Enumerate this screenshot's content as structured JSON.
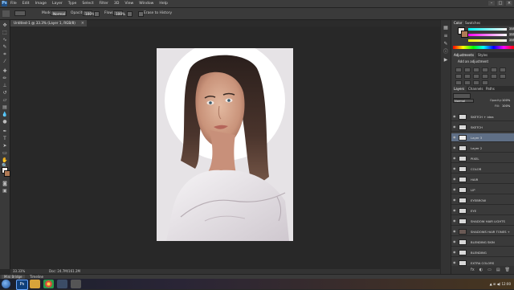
{
  "menubar": {
    "logo": "Ps",
    "items": [
      "File",
      "Edit",
      "Image",
      "Layer",
      "Type",
      "Select",
      "Filter",
      "3D",
      "View",
      "Window",
      "Help"
    ],
    "window_controls": [
      "–",
      "□",
      "×"
    ]
  },
  "options_bar": {
    "mode_label": "Mode:",
    "mode_value": "Normal",
    "opacity_label": "Opacity:",
    "opacity_value": "100%",
    "flow_label": "Flow:",
    "flow_value": "100%",
    "erase_history_label": "Erase to History"
  },
  "document_tab": {
    "title": "Untitled-1 @ 33.3% (Layer 1, RGB/8)",
    "close": "×"
  },
  "status_bar": {
    "zoom": "33.33%",
    "doc_info": "Doc: 24.7M/161.2M"
  },
  "mini_bridge": {
    "tabs": [
      "Mini Bridge",
      "Timeline"
    ]
  },
  "taskbar": {
    "apps": [
      "Ps",
      "",
      "",
      "",
      ""
    ],
    "tray_text": "▲ ⊞ ◀) 12:00"
  },
  "panels": {
    "color_tabs": [
      "Color",
      "Swatches"
    ],
    "slider_values": [
      "255",
      "255",
      "255"
    ],
    "adjust_tabs": [
      "Adjustments",
      "Styles"
    ],
    "adjust_title": "Add an adjustment",
    "layer_tabs": [
      "Layers",
      "Channels",
      "Paths"
    ],
    "blend_mode": "Normal",
    "opacity_label": "Opacity:",
    "opacity_value": "100%",
    "fill_label": "Fill:",
    "fill_value": "100%",
    "layers": [
      {
        "name": "SKETCH + idea",
        "selected": false
      },
      {
        "name": "SKETCH",
        "selected": false
      },
      {
        "name": "Layer 3",
        "selected": true
      },
      {
        "name": "Layer 2",
        "selected": false
      },
      {
        "name": "PIXEL",
        "selected": false
      },
      {
        "name": "COLOR",
        "selected": false
      },
      {
        "name": "HAIR",
        "selected": false
      },
      {
        "name": "LIP",
        "selected": false
      },
      {
        "name": "EYEBROW",
        "selected": false
      },
      {
        "name": "EYE",
        "selected": false
      },
      {
        "name": "SHADOW HAIR LIGHTS",
        "selected": false
      },
      {
        "name": "SHADOWS HAIR TONES +",
        "selected": false
      },
      {
        "name": "BLENDING SKIN",
        "selected": false
      },
      {
        "name": "BLENDING",
        "selected": false
      },
      {
        "name": "EXTRA COLORS",
        "selected": false
      }
    ],
    "footer_icons": [
      "fx",
      "◐",
      "▭",
      "▤",
      "🗑"
    ]
  },
  "colors": {
    "foreground": "#f4efeb",
    "background": "#b07a55",
    "selected_layer": "#5f6f86"
  }
}
